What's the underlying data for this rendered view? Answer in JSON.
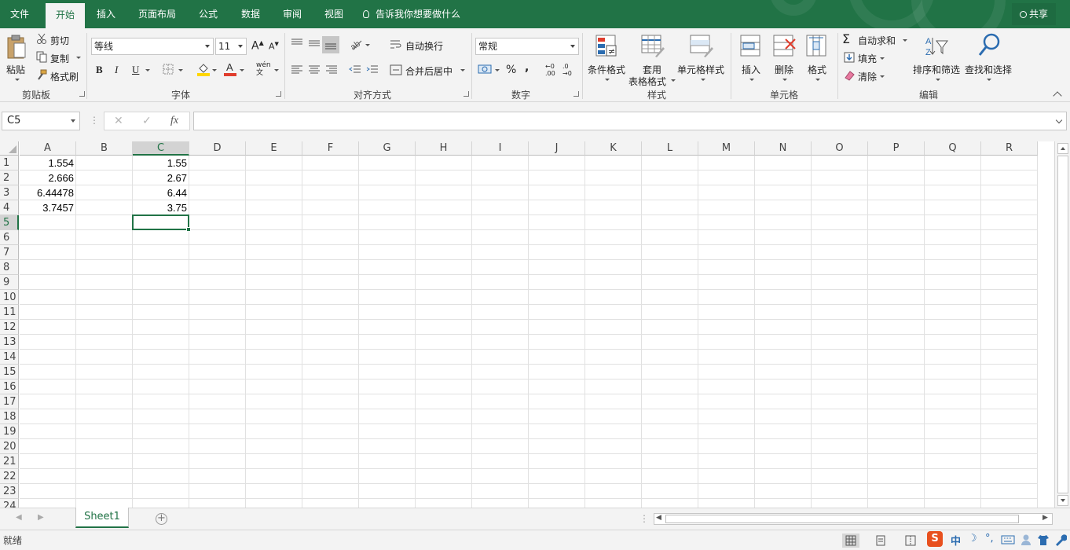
{
  "colors": {
    "accent": "#217346",
    "selection_border": "#217346",
    "font_color_bar": "#e03d2d",
    "fill_color_bar": "#ffd600"
  },
  "tabs": [
    {
      "label": "文件"
    },
    {
      "label": "开始",
      "active": true
    },
    {
      "label": "插入"
    },
    {
      "label": "页面布局"
    },
    {
      "label": "公式"
    },
    {
      "label": "数据"
    },
    {
      "label": "审阅"
    },
    {
      "label": "视图"
    }
  ],
  "tell_me": "告诉我你想要做什么",
  "share": "共享",
  "ribbon": {
    "clipboard": {
      "label": "剪贴板",
      "paste": "粘贴",
      "cut": "剪切",
      "copy": "复制",
      "format_painter": "格式刷"
    },
    "font": {
      "label": "字体",
      "font_name": "等线",
      "font_size": "11",
      "bold": "B",
      "italic": "I",
      "underline": "U",
      "grow": "A",
      "shrink": "A",
      "pinyin": "wén"
    },
    "alignment": {
      "label": "对齐方式",
      "wrap_text": "自动换行",
      "merge_center": "合并后居中"
    },
    "number": {
      "label": "数字",
      "format": "常规",
      "percent": "%",
      "comma": ",",
      "inc_decimal": ".00",
      "dec_decimal": ".0"
    },
    "styles": {
      "label": "样式",
      "conditional": "条件格式",
      "table_line1": "套用",
      "table_line2": "表格格式",
      "cell_styles": "单元格样式"
    },
    "cells": {
      "label": "单元格",
      "insert": "插入",
      "delete": "删除",
      "format": "格式"
    },
    "editing": {
      "label": "编辑",
      "autosum": "自动求和",
      "fill": "填充",
      "clear": "清除",
      "sort_filter": "排序和筛选",
      "find_select": "查找和选择"
    }
  },
  "formula_bar": {
    "name_box": "C5",
    "cancel": "✕",
    "enter": "✓",
    "fx": "fx",
    "value": ""
  },
  "grid": {
    "columns": [
      "A",
      "B",
      "C",
      "D",
      "E",
      "F",
      "G",
      "H",
      "I",
      "J",
      "K",
      "L",
      "M",
      "N",
      "O",
      "P",
      "Q",
      "R"
    ],
    "rows": [
      "1",
      "2",
      "3",
      "4",
      "5",
      "6",
      "7",
      "8",
      "9",
      "10",
      "11",
      "12",
      "13",
      "14",
      "15",
      "16",
      "17",
      "18",
      "19",
      "20",
      "21",
      "22",
      "23",
      "24"
    ],
    "selected_cell": "C5",
    "cells": {
      "A1": "1.554",
      "C1": "1.55",
      "A2": "2.666",
      "C2": "2.67",
      "A3": "6.44478",
      "C3": "6.44",
      "A4": "3.7457",
      "C4": "3.75"
    }
  },
  "sheets": [
    {
      "name": "Sheet1",
      "active": true
    }
  ],
  "status": {
    "text": "就绪"
  },
  "ime": {
    "logo": "S",
    "mode": "中",
    "moon": "☽",
    "punct": "°,"
  }
}
